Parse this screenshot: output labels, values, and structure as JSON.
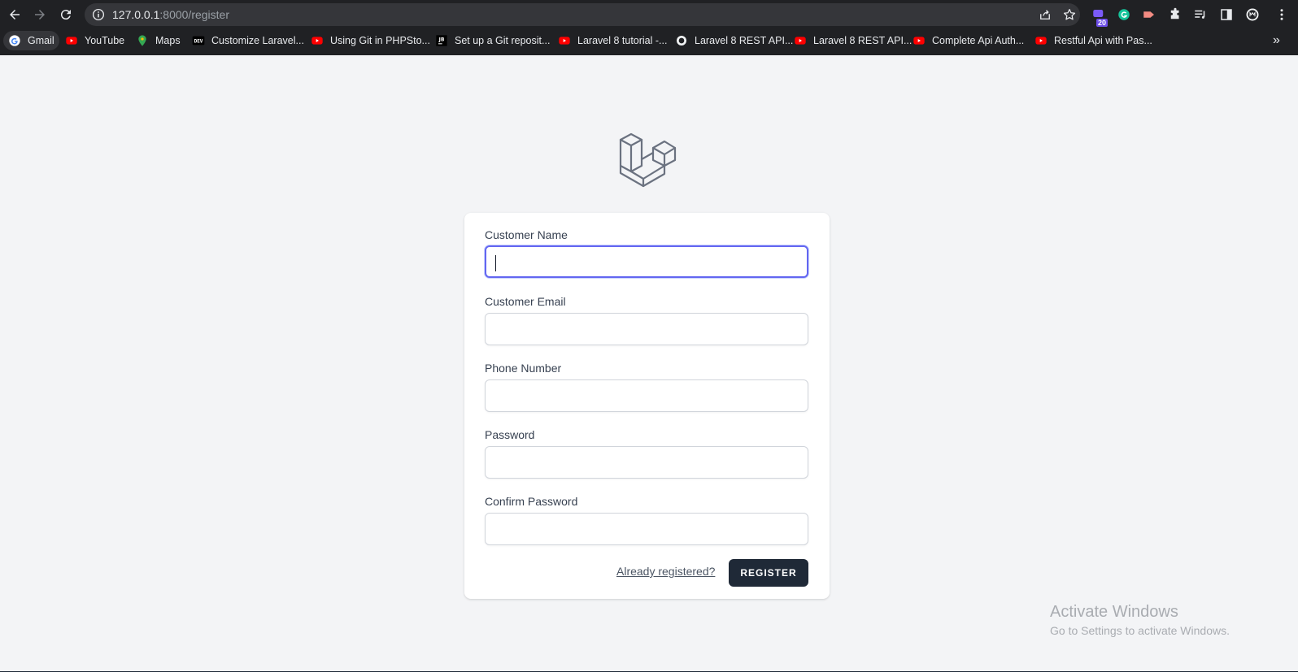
{
  "browser": {
    "url_host": "127.0.0.1",
    "url_rest": ":8000/register",
    "extension_badge": "20",
    "bookmarks": [
      {
        "label": "Gmail",
        "icon": "google-icon"
      },
      {
        "label": "YouTube",
        "icon": "youtube-icon"
      },
      {
        "label": "Maps",
        "icon": "maps-pin-icon"
      },
      {
        "label": "Customize Laravel...",
        "icon": "dev-icon"
      },
      {
        "label": "Using Git in PHPSto...",
        "icon": "youtube-icon"
      },
      {
        "label": "Set up a Git reposit...",
        "icon": "jetbrains-icon"
      },
      {
        "label": "Laravel 8 tutorial -...",
        "icon": "youtube-icon"
      },
      {
        "label": "Laravel 8 REST API...",
        "icon": "site-icon"
      },
      {
        "label": "Laravel 8 REST API...",
        "icon": "youtube-icon"
      },
      {
        "label": "Complete Api Auth...",
        "icon": "youtube-icon"
      },
      {
        "label": "Restful Api with Pas...",
        "icon": "youtube-icon"
      }
    ],
    "more_bookmarks": "»"
  },
  "form": {
    "fields": [
      {
        "label": "Customer Name",
        "value": "",
        "focused": true
      },
      {
        "label": "Customer Email",
        "value": ""
      },
      {
        "label": "Phone Number",
        "value": ""
      },
      {
        "label": "Password",
        "value": ""
      },
      {
        "label": "Confirm Password",
        "value": ""
      }
    ],
    "already_registered": "Already registered?",
    "register_button": "REGISTER"
  },
  "watermark": {
    "line1": "Activate Windows",
    "line2": "Go to Settings to activate Windows."
  },
  "colors": {
    "page_bg": "#f3f4f6",
    "chrome_bg": "#202124",
    "focus_ring": "#6366f1",
    "button_bg": "#1f2937"
  }
}
